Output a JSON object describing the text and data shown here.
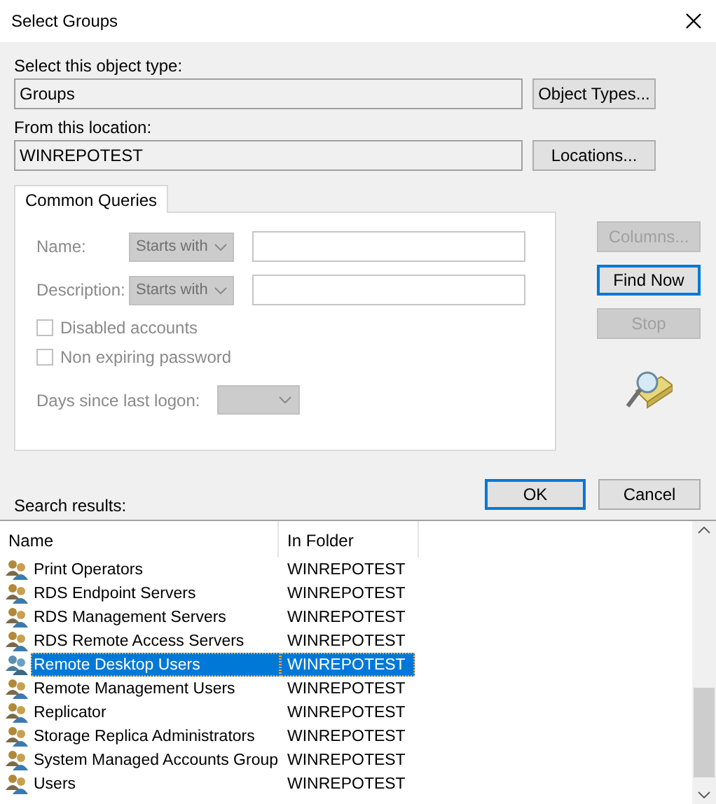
{
  "window": {
    "title": "Select Groups"
  },
  "object_type": {
    "label": "Select this object type:",
    "value": "Groups",
    "button": "Object Types..."
  },
  "location": {
    "label": "From this location:",
    "value": "WINREPOTEST",
    "button": "Locations..."
  },
  "tabs": [
    {
      "label": "Common Queries",
      "selected": true
    }
  ],
  "queries": {
    "disabled": true,
    "fields": [
      {
        "label": "Name:",
        "operator": "Starts with"
      },
      {
        "label": "Description:",
        "operator": "Starts with"
      }
    ],
    "checkboxes": [
      {
        "label": "Disabled accounts",
        "checked": false
      },
      {
        "label": "Non expiring password",
        "checked": false
      }
    ],
    "days": {
      "label": "Days since last logon:"
    }
  },
  "side_buttons": [
    {
      "label": "Columns...",
      "disabled": true,
      "default": false
    },
    {
      "label": "Find Now",
      "disabled": false,
      "default": true
    },
    {
      "label": "Stop",
      "disabled": true,
      "default": false
    }
  ],
  "dialog_buttons": [
    {
      "label": "OK",
      "default": true
    },
    {
      "label": "Cancel",
      "default": false
    }
  ],
  "results": {
    "label": "Search results:",
    "columns": [
      "Name",
      "In Folder"
    ],
    "rows": [
      {
        "name": "Print Operators",
        "folder": "WINREPOTEST",
        "selected": false
      },
      {
        "name": "RDS Endpoint Servers",
        "folder": "WINREPOTEST",
        "selected": false
      },
      {
        "name": "RDS Management Servers",
        "folder": "WINREPOTEST",
        "selected": false
      },
      {
        "name": "RDS Remote Access Servers",
        "folder": "WINREPOTEST",
        "selected": false
      },
      {
        "name": "Remote Desktop Users",
        "folder": "WINREPOTEST",
        "selected": true
      },
      {
        "name": "Remote Management Users",
        "folder": "WINREPOTEST",
        "selected": false
      },
      {
        "name": "Replicator",
        "folder": "WINREPOTEST",
        "selected": false
      },
      {
        "name": "Storage Replica Administrators",
        "folder": "WINREPOTEST",
        "selected": false
      },
      {
        "name": "System Managed Accounts Group",
        "folder": "WINREPOTEST",
        "selected": false
      },
      {
        "name": "Users",
        "folder": "WINREPOTEST",
        "selected": false
      }
    ]
  }
}
